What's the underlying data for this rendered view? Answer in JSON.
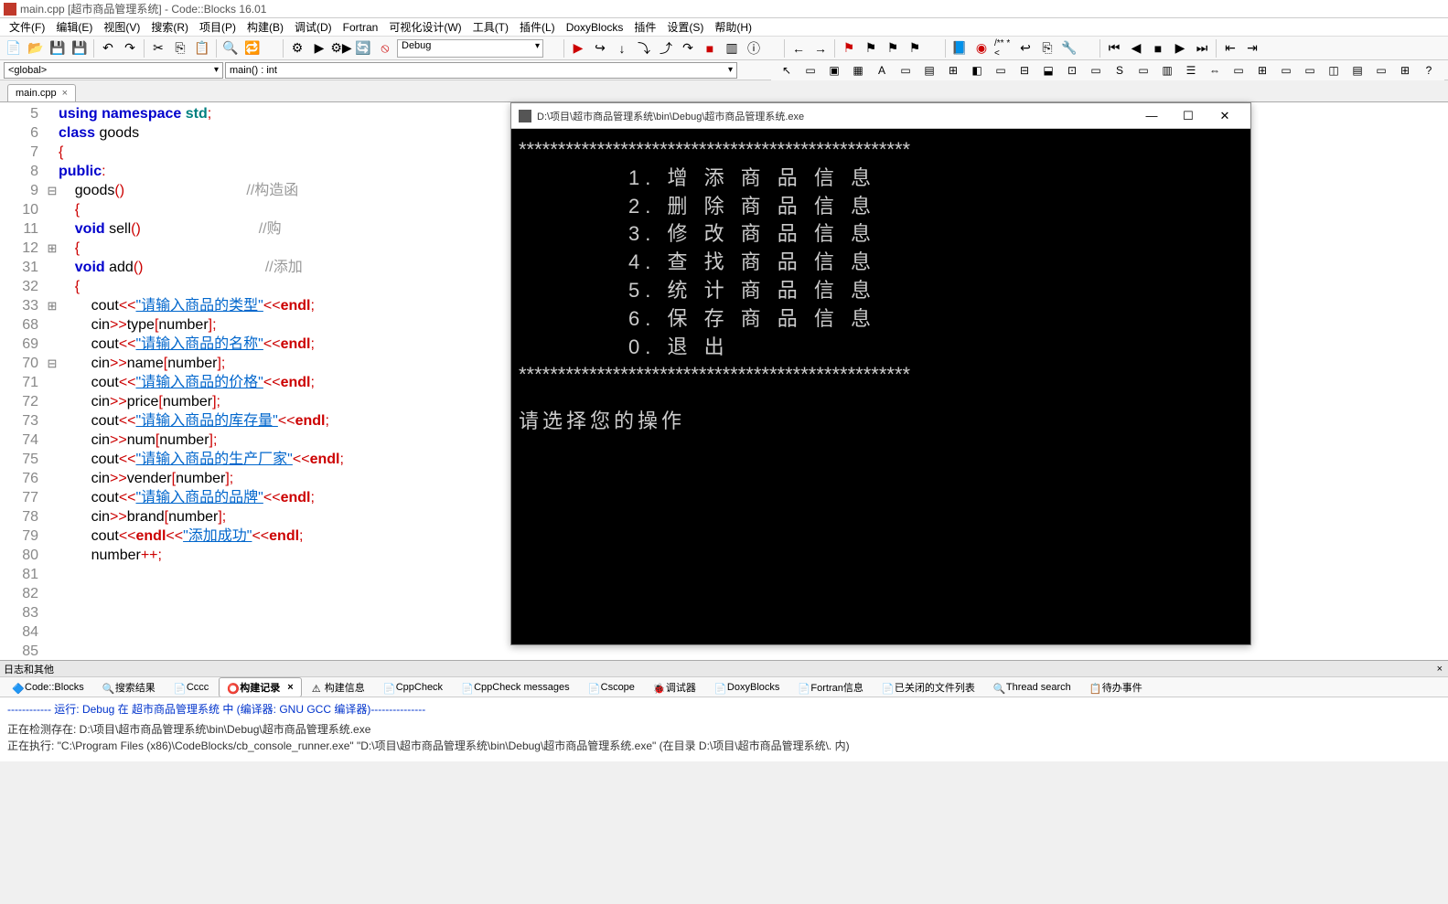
{
  "titlebar": {
    "text": "main.cpp [超市商品管理系统] - Code::Blocks 16.01"
  },
  "menus": [
    "文件(F)",
    "编辑(E)",
    "视图(V)",
    "搜索(R)",
    "项目(P)",
    "构建(B)",
    "调试(D)",
    "Fortran",
    "可视化设计(W)",
    "工具(T)",
    "插件(L)",
    "DoxyBlocks",
    "插件",
    "设置(S)",
    "帮助(H)"
  ],
  "toolbar": {
    "debug_label": "Debug",
    "doxy": "/** *<"
  },
  "scope": {
    "global": "<global>",
    "func": "main() : int"
  },
  "tab": {
    "name": "main.cpp"
  },
  "gutter_lines": [
    "5",
    "6",
    "7",
    "8",
    "9",
    "10",
    "11",
    "12",
    "31",
    "32",
    "33",
    "68",
    "69",
    "70",
    "71",
    "72",
    "73",
    "74",
    "75",
    "76",
    "77",
    "78",
    "79",
    "80",
    "81",
    "82",
    "83",
    "84",
    "85"
  ],
  "fold_marks": {
    "9": "⊟",
    "12": "⊞",
    "33": "⊞",
    "70": "⊟"
  },
  "code_lines": [
    {
      "t": ""
    },
    {
      "t": "<kw>using</kw> <kw>namespace</kw> <kw2>std</kw2><op>;</op>"
    },
    {
      "t": ""
    },
    {
      "t": "<kw>class</kw> <ident>goods</ident>"
    },
    {
      "t": "<op>{</op>"
    },
    {
      "t": "<kw>public</kw><op>:</op>"
    },
    {
      "t": "    <ident>goods</ident><op>()</op>                              <cmt>//构造函</cmt>"
    },
    {
      "t": "    <op>{</op>"
    },
    {
      "t": ""
    },
    {
      "t": "    <kw>void</kw> <ident>sell</ident><op>()</op>                             <cmt>//购</cmt>"
    },
    {
      "t": "    <op>{</op>"
    },
    {
      "t": ""
    },
    {
      "t": "    <kw>void</kw> <ident>add</ident><op>()</op>                              <cmt>//添加</cmt>"
    },
    {
      "t": "    <op>{</op>"
    },
    {
      "t": ""
    },
    {
      "t": "        <ident>cout</ident><op><<</op><str>\"请输入商品的类型\"</str><op><<</op><endlkw>endl</endlkw><op>;</op>"
    },
    {
      "t": "        <ident>cin</ident><op>>></op><ident>type</ident><op>[</op><ident>number</ident><op>];</op>"
    },
    {
      "t": "        <ident>cout</ident><op><<</op><str>\"请输入商品的名称\"</str><op><<</op><endlkw>endl</endlkw><op>;</op>"
    },
    {
      "t": "        <ident>cin</ident><op>>></op><ident>name</ident><op>[</op><ident>number</ident><op>];</op>"
    },
    {
      "t": "        <ident>cout</ident><op><<</op><str>\"请输入商品的价格\"</str><op><<</op><endlkw>endl</endlkw><op>;</op>"
    },
    {
      "t": "        <ident>cin</ident><op>>></op><ident>price</ident><op>[</op><ident>number</ident><op>];</op>"
    },
    {
      "t": "        <ident>cout</ident><op><<</op><str>\"请输入商品的库存量\"</str><op><<</op><endlkw>endl</endlkw><op>;</op>"
    },
    {
      "t": "        <ident>cin</ident><op>>></op><ident>num</ident><op>[</op><ident>number</ident><op>];</op>"
    },
    {
      "t": "        <ident>cout</ident><op><<</op><str>\"请输入商品的生产厂家\"</str><op><<</op><endlkw>endl</endlkw><op>;</op>"
    },
    {
      "t": "        <ident>cin</ident><op>>></op><ident>vender</ident><op>[</op><ident>number</ident><op>];</op>"
    },
    {
      "t": "        <ident>cout</ident><op><<</op><str>\"请输入商品的品牌\"</str><op><<</op><endlkw>endl</endlkw><op>;</op>"
    },
    {
      "t": "        <ident>cin</ident><op>>></op><ident>brand</ident><op>[</op><ident>number</ident><op>];</op>"
    },
    {
      "t": "        <ident>cout</ident><op><<</op><endlkw>endl</endlkw><op><<</op><str>\"添加成功\"</str><op><<</op><endlkw>endl</endlkw><op>;</op>"
    },
    {
      "t": "        <ident>number</ident><op>++;</op>"
    }
  ],
  "console": {
    "title": "D:\\项目\\超市商品管理系统\\bin\\Debug\\超市商品管理系统.exe",
    "divider": "**************************************************",
    "menu": [
      "1. 增 添 商 品 信 息",
      "2. 删 除 商 品 信 息",
      "3. 修 改 商 品 信 息",
      "4. 查 找 商 品 信 息",
      "5. 统 计 商 品 信 息",
      "6. 保 存 商 品 信 息",
      "0. 退 出"
    ],
    "prompt": "请选择您的操作"
  },
  "log": {
    "header": "日志和其他",
    "tabs": [
      "Code::Blocks",
      "搜索结果",
      "Cccc",
      "构建记录",
      "构建信息",
      "CppCheck",
      "CppCheck messages",
      "Cscope",
      "调试器",
      "DoxyBlocks",
      "Fortran信息",
      "已关闭的文件列表",
      "Thread search",
      "待办事件"
    ],
    "active_tab": 3,
    "line1": "------------ 运行: Debug 在 超市商品管理系统 中 (编译器: GNU GCC 编译器)---------------",
    "line2": "正在检测存在:  D:\\项目\\超市商品管理系统\\bin\\Debug\\超市商品管理系统.exe",
    "line3": "正在执行:  \"C:\\Program Files (x86)\\CodeBlocks/cb_console_runner.exe\" \"D:\\项目\\超市商品管理系统\\bin\\Debug\\超市商品管理系统.exe\"  (在目录 D:\\项目\\超市商品管理系统\\. 内)"
  }
}
